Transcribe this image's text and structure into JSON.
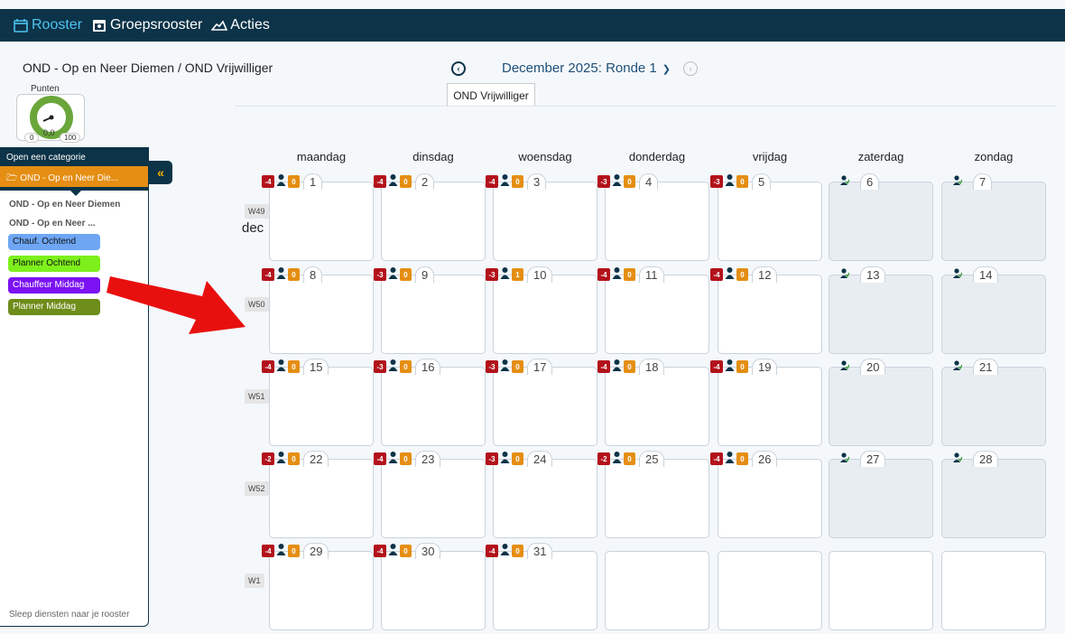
{
  "nav": [
    {
      "label": "Rooster",
      "icon": "calendar-icon",
      "active": true
    },
    {
      "label": "Groepsrooster",
      "icon": "group-calendar-icon",
      "active": false
    },
    {
      "label": "Acties",
      "icon": "handshake-icon",
      "active": false
    }
  ],
  "header": {
    "title": "OND - Op en Neer Diemen / OND Vrijwilliger",
    "month_label": "December 2025: Ronde 1",
    "subtab": "OND Vrijwilliger"
  },
  "gauge": {
    "label": "Punten",
    "value": "0,0",
    "min": "0",
    "max": "100",
    "color": "#6aa63a"
  },
  "sidebar": {
    "header": "Open een categorie",
    "folder": "OND - Op en Neer Die...",
    "group1": "OND - Op en Neer Diemen",
    "group2": "OND - Op en Neer ...",
    "pills": [
      {
        "label": "Chauf. Ochtend",
        "color": "#6ea6f4"
      },
      {
        "label": "Planner Ochtend",
        "color": "#7df01c"
      },
      {
        "label": "Chauffeur Middag",
        "color": "#7b12f2"
      },
      {
        "label": "Planner Middag",
        "color": "#6e8d1a"
      }
    ],
    "footer": "Sleep diensten naar je rooster"
  },
  "weekdays": [
    "maandag",
    "dinsdag",
    "woensdag",
    "donderdag",
    "vrijdag",
    "zaterdag",
    "zondag"
  ],
  "month_short": "dec",
  "weeks": [
    {
      "tag": "W49",
      "days": [
        {
          "n": "1",
          "red": "-4",
          "orange": "0"
        },
        {
          "n": "2",
          "red": "-4",
          "orange": "0"
        },
        {
          "n": "3",
          "red": "-4",
          "orange": "0"
        },
        {
          "n": "4",
          "red": "-3",
          "orange": "0"
        },
        {
          "n": "5",
          "red": "-3",
          "orange": "0"
        },
        {
          "n": "6",
          "weekend": true
        },
        {
          "n": "7",
          "weekend": true
        }
      ]
    },
    {
      "tag": "W50",
      "days": [
        {
          "n": "8",
          "red": "-4",
          "orange": "0"
        },
        {
          "n": "9",
          "red": "-3",
          "orange": "0"
        },
        {
          "n": "10",
          "red": "-3",
          "orange": "1"
        },
        {
          "n": "11",
          "red": "-4",
          "orange": "0"
        },
        {
          "n": "12",
          "red": "-4",
          "orange": "0"
        },
        {
          "n": "13",
          "weekend": true
        },
        {
          "n": "14",
          "weekend": true
        }
      ]
    },
    {
      "tag": "W51",
      "days": [
        {
          "n": "15",
          "red": "-4",
          "orange": "0"
        },
        {
          "n": "16",
          "red": "-3",
          "orange": "0"
        },
        {
          "n": "17",
          "red": "-3",
          "orange": "0"
        },
        {
          "n": "18",
          "red": "-4",
          "orange": "0"
        },
        {
          "n": "19",
          "red": "-4",
          "orange": "0"
        },
        {
          "n": "20",
          "weekend": true
        },
        {
          "n": "21",
          "weekend": true
        }
      ]
    },
    {
      "tag": "W52",
      "days": [
        {
          "n": "22",
          "red": "-2",
          "orange": "0"
        },
        {
          "n": "23",
          "red": "-4",
          "orange": "0"
        },
        {
          "n": "24",
          "red": "-3",
          "orange": "0"
        },
        {
          "n": "25",
          "red": "-2",
          "orange": "0"
        },
        {
          "n": "26",
          "red": "-4",
          "orange": "0"
        },
        {
          "n": "27",
          "weekend": true
        },
        {
          "n": "28",
          "weekend": true
        }
      ]
    },
    {
      "tag": "W1",
      "days": [
        {
          "n": "29",
          "red": "-4",
          "orange": "0"
        },
        {
          "n": "30",
          "red": "-4",
          "orange": "0"
        },
        {
          "n": "31",
          "red": "-4",
          "orange": "0"
        },
        {
          "empty": true
        },
        {
          "empty": true
        },
        {
          "empty": true
        },
        {
          "empty": true
        }
      ]
    }
  ],
  "colors": {
    "navbar": "#0c3348",
    "active_nav": "#4ec3f0",
    "badge_red": "#b3121b",
    "badge_orange": "#e58e13",
    "arrow": "#e8100f"
  }
}
